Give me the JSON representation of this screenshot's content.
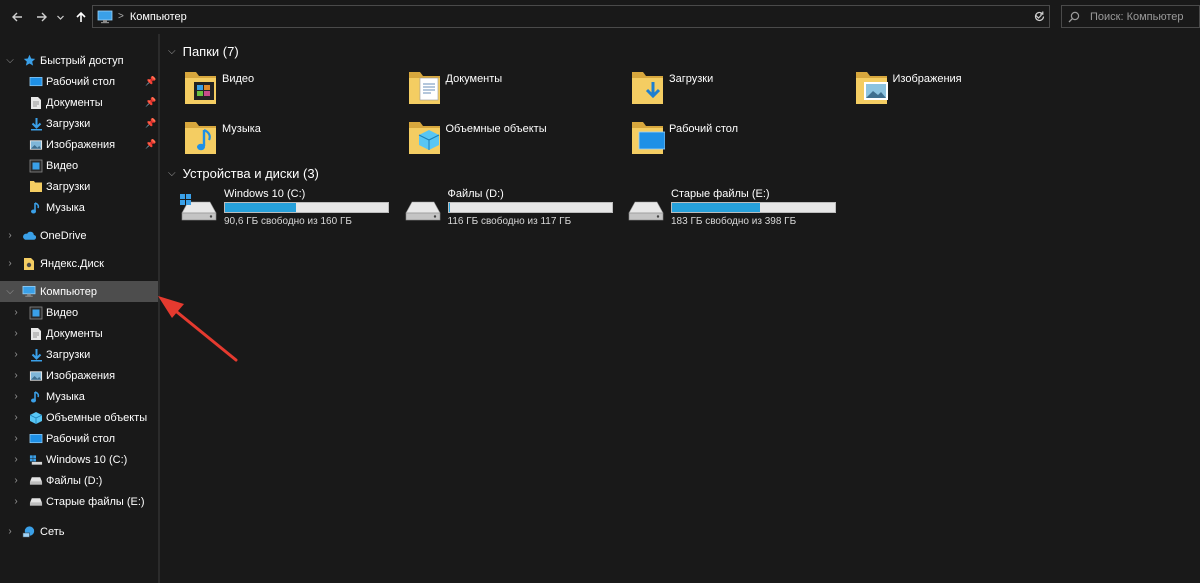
{
  "address": {
    "path": "Компьютер",
    "search_placeholder": "Поиск: Компьютер"
  },
  "sidebar": {
    "quick_access": "Быстрый доступ",
    "quick_items": [
      {
        "label": "Рабочий стол",
        "icon": "desktop-icon",
        "pinned": true
      },
      {
        "label": "Документы",
        "icon": "documents-icon",
        "pinned": true
      },
      {
        "label": "Загрузки",
        "icon": "downloads-icon",
        "pinned": true
      },
      {
        "label": "Изображения",
        "icon": "pictures-icon",
        "pinned": true
      },
      {
        "label": "Видео",
        "icon": "videos-icon",
        "pinned": false
      },
      {
        "label": "Загрузки",
        "icon": "folder-icon",
        "pinned": false
      },
      {
        "label": "Музыка",
        "icon": "music-icon",
        "pinned": false
      }
    ],
    "onedrive": "OneDrive",
    "yandex": "Яндекс.Диск",
    "computer": "Компьютер",
    "computer_items": [
      {
        "label": "Видео",
        "icon": "videos-icon"
      },
      {
        "label": "Документы",
        "icon": "documents-icon"
      },
      {
        "label": "Загрузки",
        "icon": "downloads-icon"
      },
      {
        "label": "Изображения",
        "icon": "pictures-icon"
      },
      {
        "label": "Музыка",
        "icon": "music-icon"
      },
      {
        "label": "Объемные объекты",
        "icon": "3d-objects-icon"
      },
      {
        "label": "Рабочий стол",
        "icon": "desktop-icon"
      },
      {
        "label": "Windows 10 (C:)",
        "icon": "windows-drive-icon"
      },
      {
        "label": "Файлы (D:)",
        "icon": "drive-icon"
      },
      {
        "label": "Старые файлы (E:)",
        "icon": "drive-icon"
      }
    ],
    "network": "Сеть"
  },
  "folders": {
    "heading": "Папки (7)",
    "items": [
      {
        "label": "Видео",
        "icon": "videos-folder-icon"
      },
      {
        "label": "Документы",
        "icon": "documents-folder-icon"
      },
      {
        "label": "Загрузки",
        "icon": "downloads-folder-icon"
      },
      {
        "label": "Изображения",
        "icon": "pictures-folder-icon"
      },
      {
        "label": "Музыка",
        "icon": "music-folder-icon"
      },
      {
        "label": "Объемные объекты",
        "icon": "3d-objects-folder-icon"
      },
      {
        "label": "Рабочий стол",
        "icon": "desktop-folder-icon"
      }
    ]
  },
  "drives": {
    "heading": "Устройства и диски (3)",
    "items": [
      {
        "name": "Windows 10 (C:)",
        "free": "90,6 ГБ свободно из 160 ГБ",
        "used_fraction": 0.434,
        "icon": "windows-drive-icon"
      },
      {
        "name": "Файлы (D:)",
        "free": "116 ГБ свободно из 117 ГБ",
        "used_fraction": 0.01,
        "icon": "drive-icon"
      },
      {
        "name": "Старые файлы (E:)",
        "free": "183 ГБ свободно из 398 ГБ",
        "used_fraction": 0.54,
        "icon": "drive-icon"
      }
    ]
  },
  "colors": {
    "background": "#191919",
    "selection": "#4d4d4d",
    "bar_fill": "#26a0da",
    "annotation_arrow": "#e53a2f",
    "folder": "#f4cd62"
  }
}
